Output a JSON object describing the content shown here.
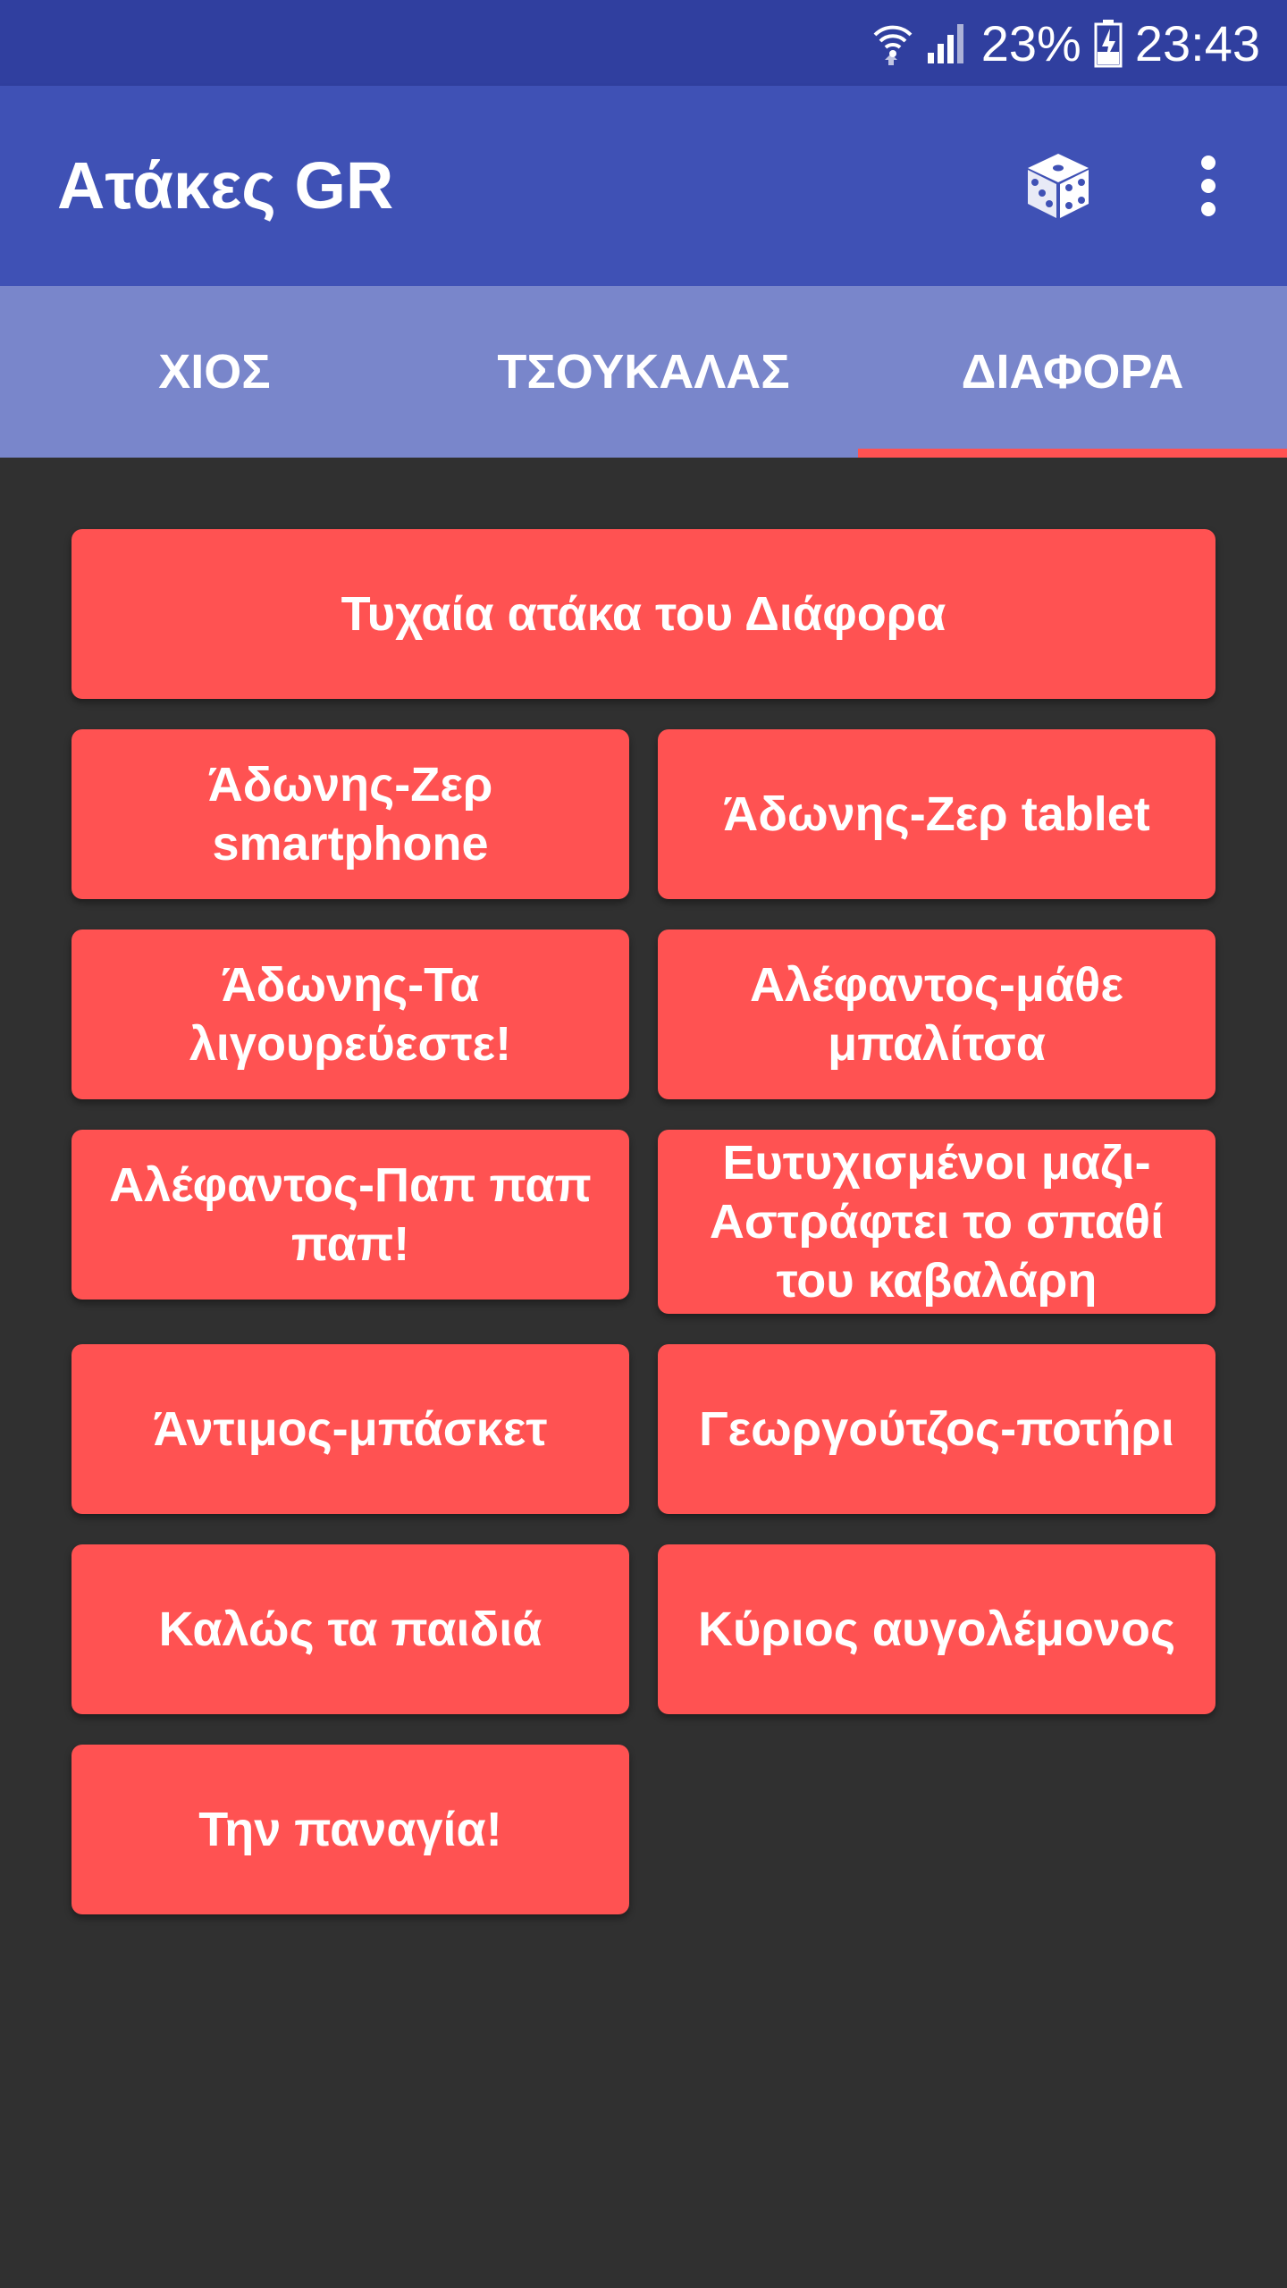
{
  "status_bar": {
    "battery_percent": "23%",
    "time": "23:43",
    "icons": [
      "wifi-icon",
      "signal-icon",
      "battery-charging-icon"
    ]
  },
  "app_bar": {
    "title": "Ατάκες GR",
    "actions": [
      "dice-icon",
      "more-vert-icon"
    ]
  },
  "tabs": [
    {
      "label": "ΧΙΟΣ",
      "selected": false
    },
    {
      "label": "ΤΣΟΥΚΑΛΑΣ",
      "selected": false
    },
    {
      "label": "ΔΙΑΦΟΡΑ",
      "selected": true
    }
  ],
  "random_button": {
    "label": "Τυχαία ατάκα του Διάφορα"
  },
  "quote_buttons": [
    {
      "label": "Άδωνης-Ζερ smartphone"
    },
    {
      "label": "Άδωνης-Ζερ tablet"
    },
    {
      "label": "Άδωνης-Τα λιγουρεύεστε!"
    },
    {
      "label": "Αλέφαντος-μάθε μπαλίτσα"
    },
    {
      "label": "Αλέφαντος-Παπ παπ παπ!"
    },
    {
      "label": "Ευτυχισμένοι μαζι-Αστράφτει το σπαθί του καβαλάρη"
    },
    {
      "label": "Άντιμος-μπάσκετ"
    },
    {
      "label": "Γεωργούτζος-ποτήρι"
    },
    {
      "label": "Καλώς τα παιδιά"
    },
    {
      "label": "Κύριος αυγολέμονος"
    },
    {
      "label": "Την παναγία!"
    }
  ],
  "colors": {
    "status_bar": "#303f9f",
    "app_bar": "#3f51b5",
    "tab_bar": "#7986cb",
    "accent": "#ff5252",
    "background": "#303030"
  }
}
